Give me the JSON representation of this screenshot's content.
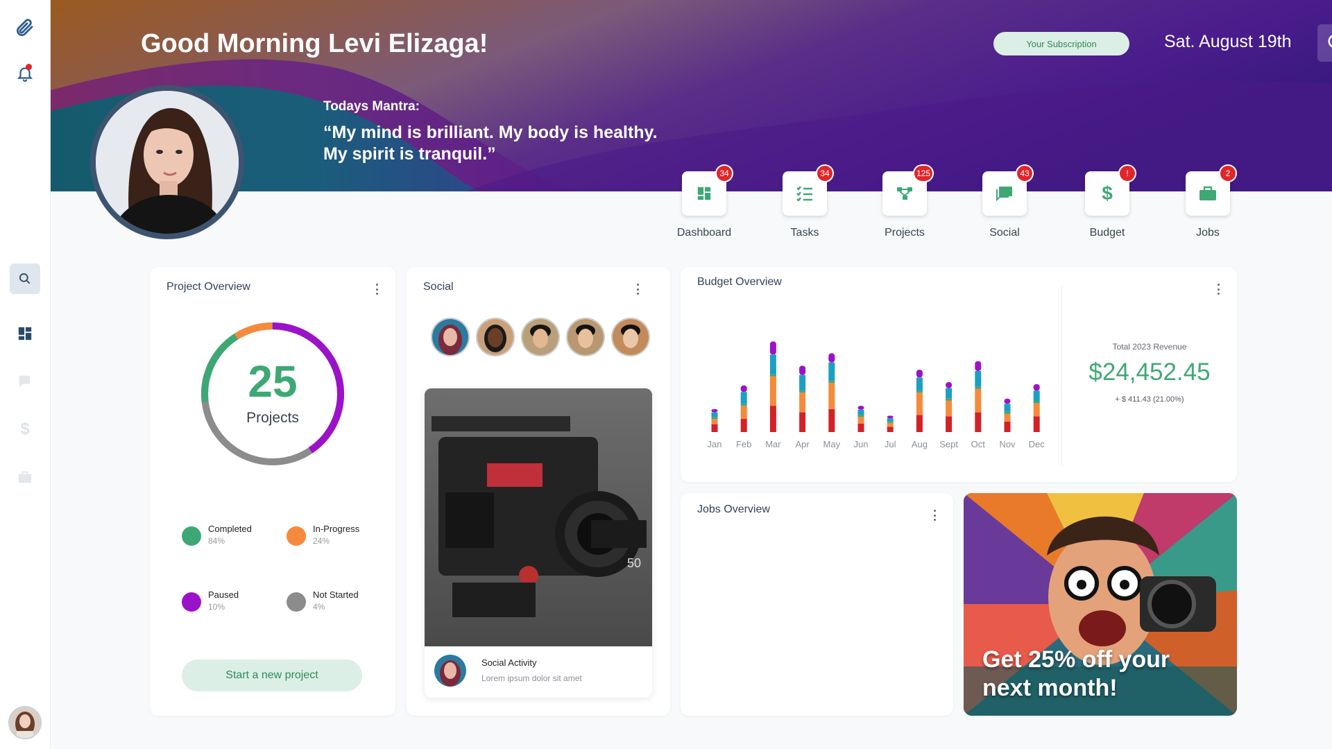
{
  "header": {
    "greeting": "Good Morning Levi Elizaga!",
    "mantra_label": "Todays Mantra:",
    "mantra_line1": "“My mind is brilliant. My body is healthy.",
    "mantra_line2": "My spirit is tranquil.”",
    "subscription_label": "Your Subscription",
    "date": "Sat. August 19th"
  },
  "sidebar": {
    "items": [
      {
        "icon": "paperclip-icon",
        "active": false
      },
      {
        "icon": "bell-icon",
        "active": false,
        "has_notification": true
      },
      {
        "icon": "search-icon",
        "active": true
      },
      {
        "icon": "dashboard-icon",
        "active": false
      },
      {
        "icon": "chat-icon",
        "active": false
      },
      {
        "icon": "dollar-icon",
        "active": false
      },
      {
        "icon": "briefcase-icon",
        "active": false
      }
    ]
  },
  "quick_nav": [
    {
      "label": "Dashboard",
      "badge": "34",
      "icon": "dashboard-icon"
    },
    {
      "label": "Tasks",
      "badge": "34",
      "icon": "tasks-icon"
    },
    {
      "label": "Projects",
      "badge": "125",
      "icon": "projects-icon"
    },
    {
      "label": "Social",
      "badge": "43",
      "icon": "chat-icon"
    },
    {
      "label": "Budget",
      "badge": "!",
      "icon": "dollar-icon"
    },
    {
      "label": "Jobs",
      "badge": "2",
      "icon": "briefcase-icon"
    }
  ],
  "project_overview": {
    "title": "Project Overview",
    "count": "25",
    "count_label": "Projects",
    "legend": [
      {
        "name": "Completed",
        "pct": "84%",
        "color": "#3ea874"
      },
      {
        "name": "In-Progress",
        "pct": "24%",
        "color": "#f58a3c"
      },
      {
        "name": "Paused",
        "pct": "10%",
        "color": "#9b12c9"
      },
      {
        "name": "Not Started",
        "pct": "4%",
        "color": "#8c8c8c"
      }
    ],
    "start_button": "Start a new project"
  },
  "social": {
    "title": "Social",
    "activity_title": "Social Activity",
    "activity_sub": "Lorem ipsum dolor sit amet"
  },
  "budget": {
    "title": "Budget Overview",
    "revenue_label": "Total 2023 Revenue",
    "revenue_value": "$24,452.45",
    "revenue_change": "+ $ 411.43 (21.00%)"
  },
  "jobs": {
    "title": "Jobs Overview"
  },
  "promo": {
    "line1": "Get 25% off your",
    "line2": "next month!"
  },
  "colors": {
    "accent_green": "#3ea874",
    "badge_red": "#e0262b",
    "series_red": "#d32128",
    "series_orange": "#f58a3c",
    "series_teal": "#1b9fc2",
    "series_purple": "#9b12c9"
  },
  "chart_data": {
    "type": "bar",
    "stacked": true,
    "categories": [
      "Jan",
      "Feb",
      "Mar",
      "Apr",
      "May",
      "Jun",
      "Jul",
      "Aug",
      "Sept",
      "Oct",
      "Nov",
      "Dec"
    ],
    "series": [
      {
        "values": [
          12,
          20,
          40,
          30,
          35,
          13,
          8,
          26,
          24,
          30,
          16,
          24
        ],
        "color": "#d32128"
      },
      {
        "values": [
          8,
          20,
          45,
          30,
          40,
          10,
          6,
          34,
          24,
          36,
          12,
          20
        ],
        "color": "#f58a3c"
      },
      {
        "values": [
          3,
          3,
          3,
          3,
          3,
          3,
          2,
          3,
          3,
          3,
          3,
          3
        ],
        "color": "#3ea874"
      },
      {
        "values": [
          7,
          18,
          30,
          24,
          28,
          8,
          5,
          20,
          16,
          24,
          12,
          16
        ],
        "color": "#1b9fc2"
      },
      {
        "values": [
          5,
          10,
          20,
          14,
          14,
          6,
          4,
          12,
          9,
          15,
          8,
          10
        ],
        "color": "#9b12c9"
      }
    ],
    "grid": false,
    "legend": "none"
  }
}
